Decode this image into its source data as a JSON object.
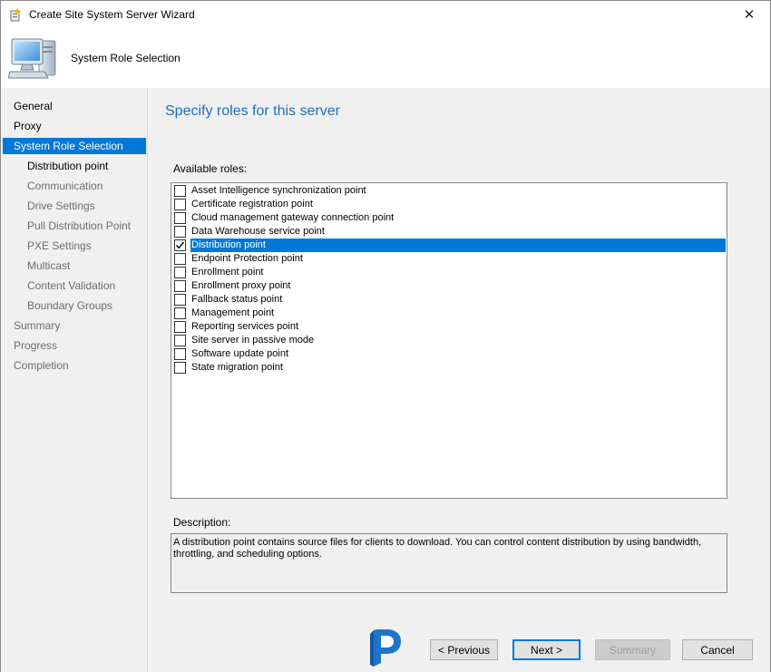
{
  "window": {
    "title": "Create Site System Server Wizard",
    "close_glyph": "✕"
  },
  "header": {
    "title": "System Role Selection",
    "icon": "computer-icon"
  },
  "nav": {
    "items": [
      {
        "label": "General",
        "state": "done",
        "level": 0
      },
      {
        "label": "Proxy",
        "state": "done",
        "level": 0
      },
      {
        "label": "System Role Selection",
        "state": "active",
        "level": 0
      },
      {
        "label": "Distribution point",
        "state": "current",
        "level": 1
      },
      {
        "label": "Communication",
        "state": "pending",
        "level": 1
      },
      {
        "label": "Drive Settings",
        "state": "pending",
        "level": 1
      },
      {
        "label": "Pull Distribution Point",
        "state": "pending",
        "level": 1
      },
      {
        "label": "PXE Settings",
        "state": "pending",
        "level": 1
      },
      {
        "label": "Multicast",
        "state": "pending",
        "level": 1
      },
      {
        "label": "Content Validation",
        "state": "pending",
        "level": 1
      },
      {
        "label": "Boundary Groups",
        "state": "pending",
        "level": 1
      },
      {
        "label": "Summary",
        "state": "pending",
        "level": 0
      },
      {
        "label": "Progress",
        "state": "pending",
        "level": 0
      },
      {
        "label": "Completion",
        "state": "pending",
        "level": 0
      }
    ]
  },
  "main": {
    "heading": "Specify roles for this server",
    "roles_label": "Available roles:",
    "roles": [
      {
        "label": "Asset Intelligence synchronization point",
        "checked": false,
        "selected": false
      },
      {
        "label": "Certificate registration point",
        "checked": false,
        "selected": false
      },
      {
        "label": "Cloud management gateway connection point",
        "checked": false,
        "selected": false
      },
      {
        "label": "Data Warehouse service point",
        "checked": false,
        "selected": false
      },
      {
        "label": "Distribution point",
        "checked": true,
        "selected": true
      },
      {
        "label": "Endpoint Protection point",
        "checked": false,
        "selected": false
      },
      {
        "label": "Enrollment point",
        "checked": false,
        "selected": false
      },
      {
        "label": "Enrollment proxy point",
        "checked": false,
        "selected": false
      },
      {
        "label": "Fallback status point",
        "checked": false,
        "selected": false
      },
      {
        "label": "Management point",
        "checked": false,
        "selected": false
      },
      {
        "label": "Reporting services point",
        "checked": false,
        "selected": false
      },
      {
        "label": "Site server in passive mode",
        "checked": false,
        "selected": false
      },
      {
        "label": "Software update point",
        "checked": false,
        "selected": false
      },
      {
        "label": "State migration point",
        "checked": false,
        "selected": false
      }
    ],
    "description_label": "Description:",
    "description": "A distribution point contains source files for clients to download. You can control content distribution by using bandwidth, throttling, and scheduling options."
  },
  "footer": {
    "previous_label": "< Previous",
    "next_label": "Next >",
    "summary_label": "Summary",
    "cancel_label": "Cancel",
    "brand_icon": "prajwal-p-logo"
  },
  "colors": {
    "accent": "#0078d7",
    "heading": "#1e6fc0",
    "panel": "#f0f0f0"
  }
}
